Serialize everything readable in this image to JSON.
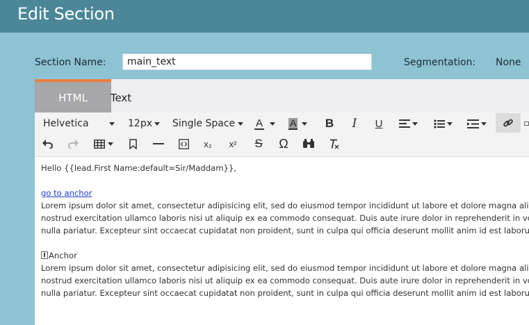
{
  "header": {
    "title": "Edit Section"
  },
  "form": {
    "section_name_label": "Section Name:",
    "section_name_value": "main_text",
    "segmentation_label": "Segmentation:",
    "segmentation_value": "None"
  },
  "tabs": [
    {
      "label": "HTML",
      "active": true
    },
    {
      "label": "Text",
      "active": false
    }
  ],
  "toolbar": {
    "font_family": "Helvetica",
    "font_size": "12px",
    "line_spacing": "Single Space",
    "text_color_glyph": "A",
    "bg_color_glyph": "A",
    "bold_glyph": "B",
    "italic_glyph": "I",
    "underline_glyph": "U",
    "strikethrough_glyph": "S",
    "special_char_glyph": "Ω",
    "subscript_glyph": "x₂",
    "superscript_glyph": "x²"
  },
  "content": {
    "greeting": "Hello {{lead.First Name:default=Sir/Maddam}},",
    "link_text": "go to anchor",
    "para1_line1": "Lorem ipsum dolor sit amet, consectetur adipisicing elit, sed do eiusmod tempor incididunt ut labore et dolore magna aliqua. Ut enim",
    "para1_line2": "nostrud exercitation ullamco laboris nisi ut aliquip ex ea commodo consequat. Duis aute irure dolor in reprehenderit in voluptate velit",
    "para1_line3": "nulla pariatur. Excepteur sint occaecat cupidatat non proident, sunt in culpa qui officia deserunt mollit anim id est laborum.",
    "anchor_label": "Anchor",
    "para2_line1": "Lorem ipsum dolor sit amet, consectetur adipisicing elit, sed do eiusmod tempor incididunt ut labore et dolore magna aliqua. Ut enim",
    "para2_line2": "nostrud exercitation ullamco laboris nisi ut aliquip ex ea commodo consequat. Duis aute irure dolor in reprehenderit in voluptate velit",
    "para2_line3": "nulla pariatur. Excepteur sint occaecat cupidatat non proident, sunt in culpa qui officia deserunt mollit anim id est laborum."
  },
  "colors": {
    "page_bg": "#8dc3d3",
    "titlebar_bg": "#4b8799",
    "active_tab_bg": "#a7a7aa",
    "active_tab_accent": "#e87d3a",
    "link": "#1a3fd6"
  }
}
